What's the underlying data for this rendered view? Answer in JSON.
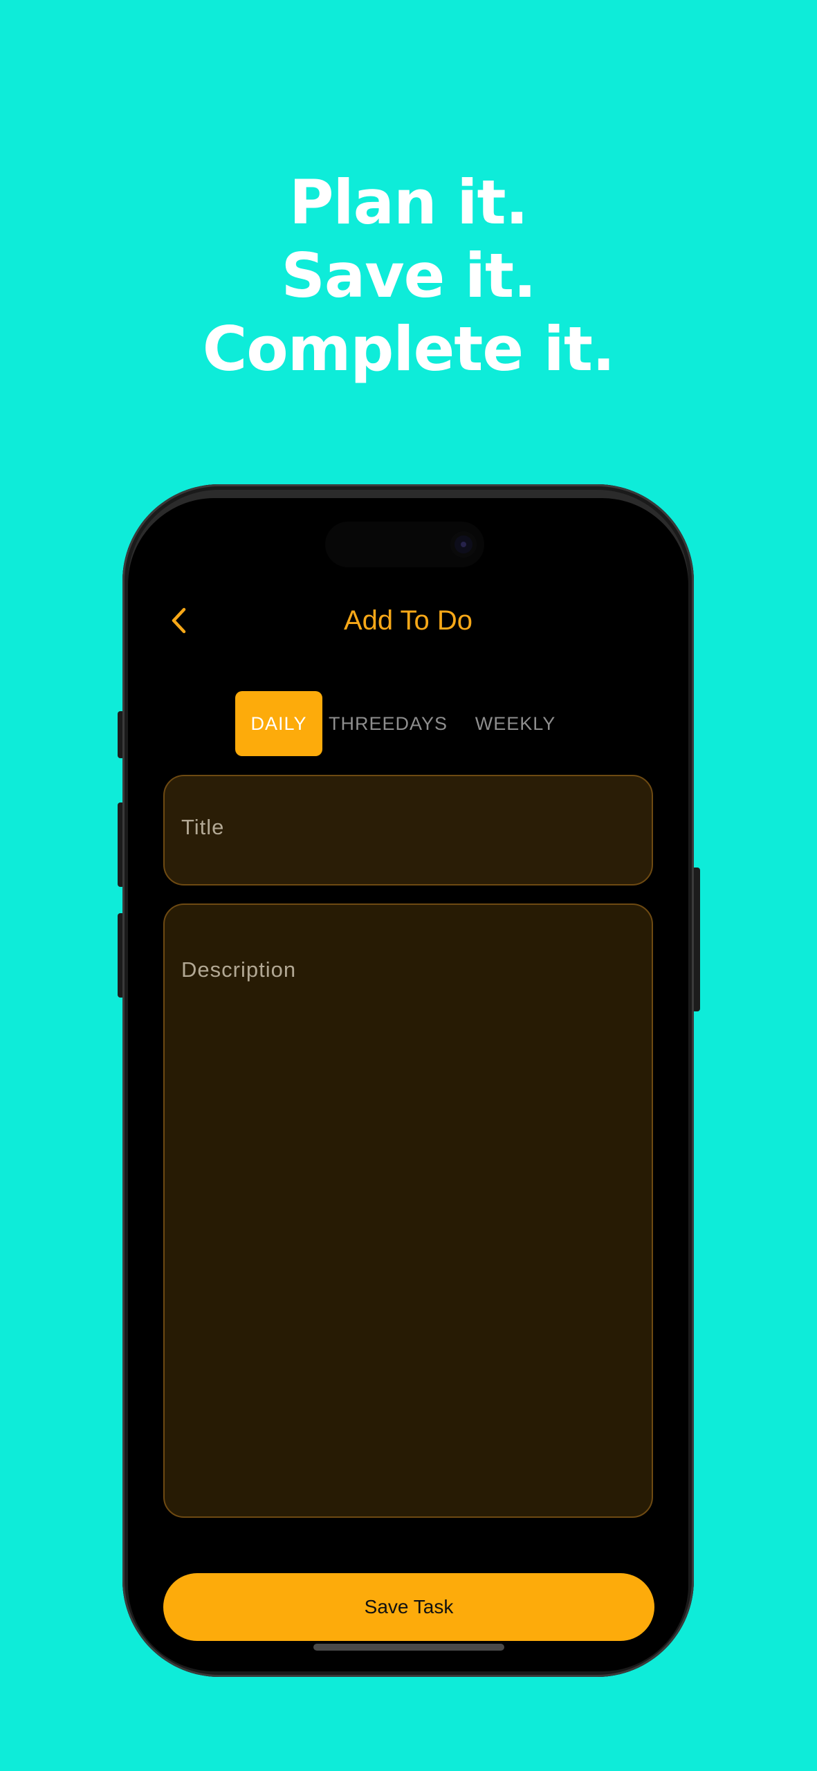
{
  "headline": {
    "line1": "Plan it.",
    "line2": "Save it.",
    "line3": "Complete it."
  },
  "colors": {
    "background": "#0eecd9",
    "accent": "#fdab0b",
    "field_fill": "#2a1d06"
  },
  "nav": {
    "back_icon": "chevron-left-icon",
    "title": "Add To Do"
  },
  "tabs": [
    {
      "label": "DAILY",
      "selected": true
    },
    {
      "label": "THREEDAYS",
      "selected": false
    },
    {
      "label": "WEEKLY",
      "selected": false
    }
  ],
  "form": {
    "title_placeholder": "Title",
    "description_placeholder": "Description"
  },
  "actions": {
    "save_label": "Save Task"
  }
}
